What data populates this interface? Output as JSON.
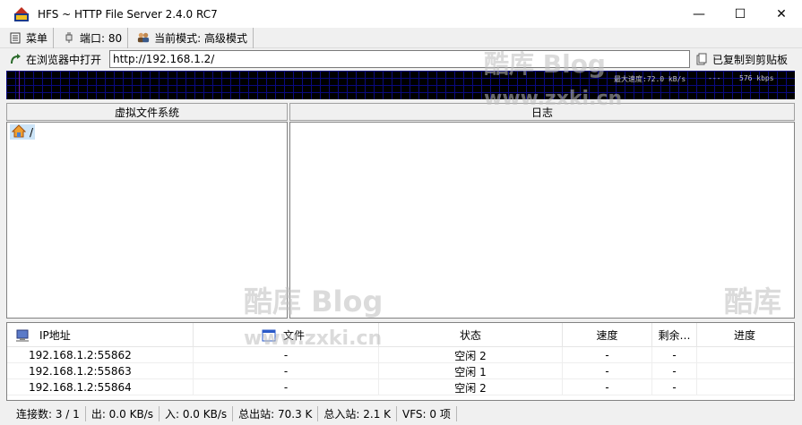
{
  "window": {
    "title": "HFS ~ HTTP File Server 2.4.0 RC7",
    "minimize_glyph": "—",
    "maximize_glyph": "☐",
    "close_glyph": "✕"
  },
  "menubar": {
    "menu_label": "菜单",
    "port_label": "端口: 80",
    "mode_label": "当前模式: 高级模式"
  },
  "urlbar": {
    "open_label": "在浏览器中打开",
    "url_value": "http://192.168.1.2/",
    "copy_label": "已复制到剪贴板"
  },
  "graph": {
    "max_speed": "最大速度:72.0 kB/s",
    "dashes": "---",
    "bandwidth": "576 kbps"
  },
  "vfs": {
    "header": "虚拟文件系统",
    "root_label": "/"
  },
  "log": {
    "header": "日志"
  },
  "connections": {
    "columns": {
      "ip": "IP地址",
      "file": "文件",
      "status": "状态",
      "speed": "速度",
      "remaining": "剩余…",
      "progress": "进度"
    },
    "rows": [
      {
        "ip": "192.168.1.2:55862",
        "file": "-",
        "status": "空闲 2",
        "speed": "-",
        "remaining": "-",
        "progress": ""
      },
      {
        "ip": "192.168.1.2:55863",
        "file": "-",
        "status": "空闲 1",
        "speed": "-",
        "remaining": "-",
        "progress": ""
      },
      {
        "ip": "192.168.1.2:55864",
        "file": "-",
        "status": "空闲 2",
        "speed": "-",
        "remaining": "-",
        "progress": ""
      }
    ]
  },
  "statusbar": {
    "connections": "连接数: 3 / 1",
    "out": "出: 0.0 KB/s",
    "in": "入: 0.0 KB/s",
    "total_out": "总出站: 70.3 K",
    "total_in": "总入站: 2.1 K",
    "vfs": "VFS: 0 项"
  },
  "watermark": {
    "blog_text": "酷库 Blog",
    "site_text": "www.zxki.cn",
    "partial_text": "酷库"
  },
  "colors": {
    "graph_bg": "#000000",
    "graph_grid": "#0a0a80",
    "selection": "#cce4f7"
  }
}
